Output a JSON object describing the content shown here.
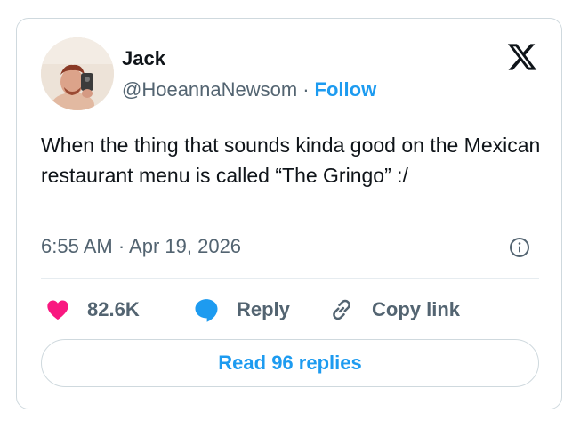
{
  "author": {
    "name": "Jack",
    "handle": "@HoeannaNewsom",
    "separator": "·",
    "follow_label": "Follow"
  },
  "tweet": {
    "text": "When the thing that sounds kinda good on the Mexican restaurant menu is called “The Gringo” :/",
    "timestamp": "6:55 AM · Apr 19, 2026"
  },
  "actions": {
    "like_count": "82.6K",
    "reply_label": "Reply",
    "copy_link_label": "Copy link"
  },
  "read_replies_label": "Read 96 replies",
  "icons": {
    "logo": "x-logo-icon",
    "info": "info-icon",
    "like": "heart-icon",
    "reply": "speech-bubble-icon",
    "copy": "link-icon"
  },
  "colors": {
    "accent": "#1d9bf0",
    "heart": "#f91880",
    "secondary_text": "#536471",
    "primary_text": "#0f1419",
    "border": "#cfd9de"
  }
}
